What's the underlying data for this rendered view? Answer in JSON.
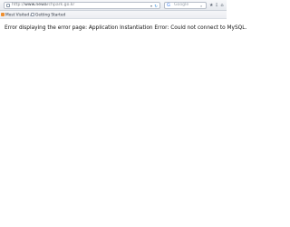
{
  "browser": {
    "url": {
      "scheme_prefix": "http://",
      "host": "www.newa",
      "rest": "rchpark.go.kr"
    },
    "search_placeholder": "Google",
    "bookmarks": [
      {
        "label": "Most Visited",
        "icon": "orange-square-icon"
      },
      {
        "label": "Getting Started",
        "icon": "document-icon"
      }
    ]
  },
  "page": {
    "error_message": "Error displaying the error page: Application Instantiation Error: Could not connect to MySQL."
  },
  "colors": {
    "accent_blue": "#2a87d7",
    "bookmark_orange": "#ef8f2f",
    "text_dark": "#111111",
    "muted_gray": "#7a7f86"
  }
}
